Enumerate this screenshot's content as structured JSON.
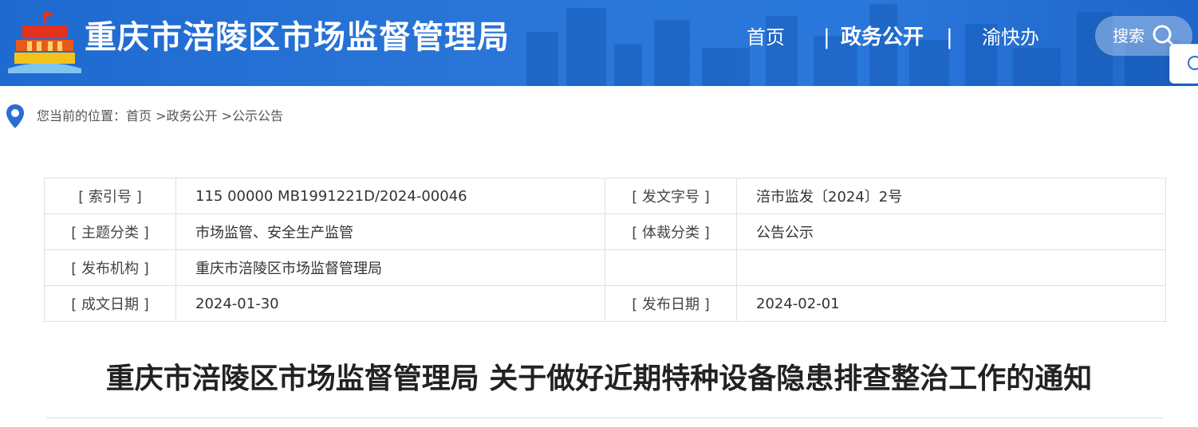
{
  "header": {
    "site_title": "重庆市涪陵区市场监督管理局",
    "nav": {
      "home": "首页",
      "sep": "|",
      "government_affairs": "政务公开",
      "yu_kuai_ban": "渝快办"
    },
    "search_label": "搜索"
  },
  "breadcrumb": {
    "prefix": "您当前的位置：",
    "home": "首页",
    "arrow": " >",
    "level1": "政务公开",
    "level2": "公示公告"
  },
  "meta_table": {
    "rows": [
      {
        "label1": "[ 索引号 ]",
        "value1": "115 00000 MB1991221D/2024-00046",
        "label2": "[ 发文字号 ]",
        "value2": "涪市监发〔2024〕2号"
      },
      {
        "label1": "[ 主题分类 ]",
        "value1": "市场监管、安全生产监管",
        "label2": "[ 体裁分类 ]",
        "value2": "公告公示"
      },
      {
        "label1": "[ 发布机构 ]",
        "value1": "重庆市涪陵区市场监督管理局",
        "label2": "",
        "value2": ""
      },
      {
        "label1": "[ 成文日期 ]",
        "value1": "2024-01-30",
        "label2": "[ 发布日期 ]",
        "value2": "2024-02-01"
      }
    ]
  },
  "article": {
    "title": "重庆市涪陵区市场监督管理局 关于做好近期特种设备隐患排查整治工作的通知"
  },
  "icons": {
    "logo": "building-emblem-logo",
    "search": "search-icon",
    "location": "location-pin-icon",
    "float": "float-tool-icon"
  },
  "colors": {
    "header_blue": "#2a76d8",
    "pin_blue": "#2a6fd0"
  }
}
